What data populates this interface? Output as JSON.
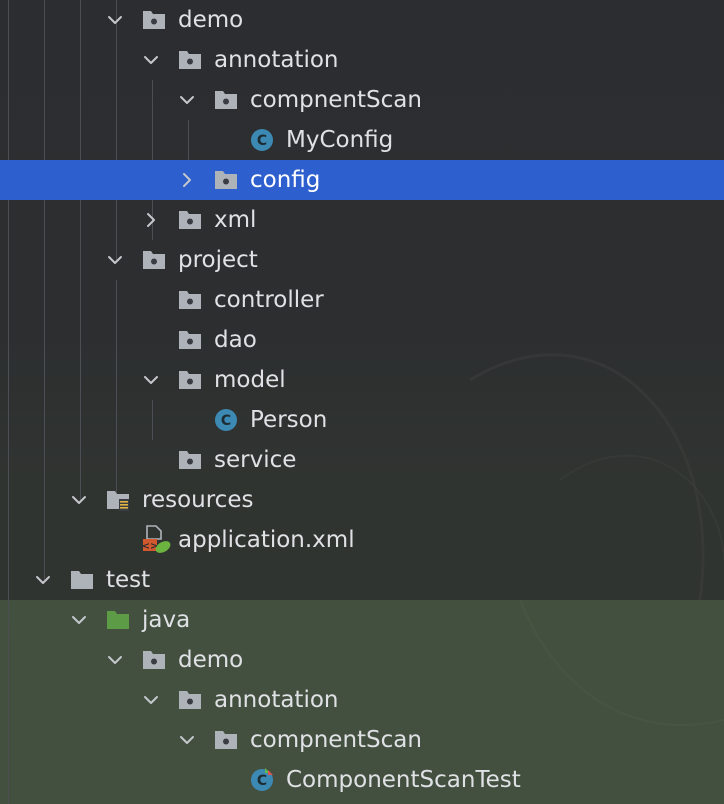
{
  "project_tree": {
    "rows": [
      {
        "label": "demo",
        "icon": "package-folder-icon",
        "expanded": true
      },
      {
        "label": "annotation",
        "icon": "package-folder-icon",
        "expanded": true
      },
      {
        "label": "compnentScan",
        "icon": "package-folder-icon",
        "expanded": true
      },
      {
        "label": "MyConfig",
        "icon": "java-class-icon"
      },
      {
        "label": "config",
        "icon": "package-folder-icon",
        "expanded": false,
        "selected": true
      },
      {
        "label": "xml",
        "icon": "package-folder-icon",
        "expanded": false
      },
      {
        "label": "project",
        "icon": "package-folder-icon",
        "expanded": true
      },
      {
        "label": "controller",
        "icon": "package-folder-icon"
      },
      {
        "label": "dao",
        "icon": "package-folder-icon"
      },
      {
        "label": "model",
        "icon": "package-folder-icon",
        "expanded": true
      },
      {
        "label": "Person",
        "icon": "java-class-icon"
      },
      {
        "label": "service",
        "icon": "package-folder-icon"
      },
      {
        "label": "resources",
        "icon": "resources-folder-icon",
        "expanded": true
      },
      {
        "label": "application.xml",
        "icon": "spring-xml-file-icon"
      },
      {
        "label": "test",
        "icon": "folder-icon",
        "expanded": true
      },
      {
        "label": "java",
        "icon": "test-sources-folder-icon",
        "expanded": true
      },
      {
        "label": "demo",
        "icon": "package-folder-icon",
        "expanded": true
      },
      {
        "label": "annotation",
        "icon": "package-folder-icon",
        "expanded": true
      },
      {
        "label": "compnentScan",
        "icon": "package-folder-icon",
        "expanded": true
      },
      {
        "label": "ComponentScanTest",
        "icon": "test-class-icon"
      }
    ]
  },
  "colors": {
    "background": "#2b2d30",
    "selection": "#2e5fcf",
    "text": "#dfe1e5",
    "folder_icon": "#aeb3b9",
    "test_folder_icon": "#5d9b47",
    "class_icon": "#3c8ab4"
  }
}
